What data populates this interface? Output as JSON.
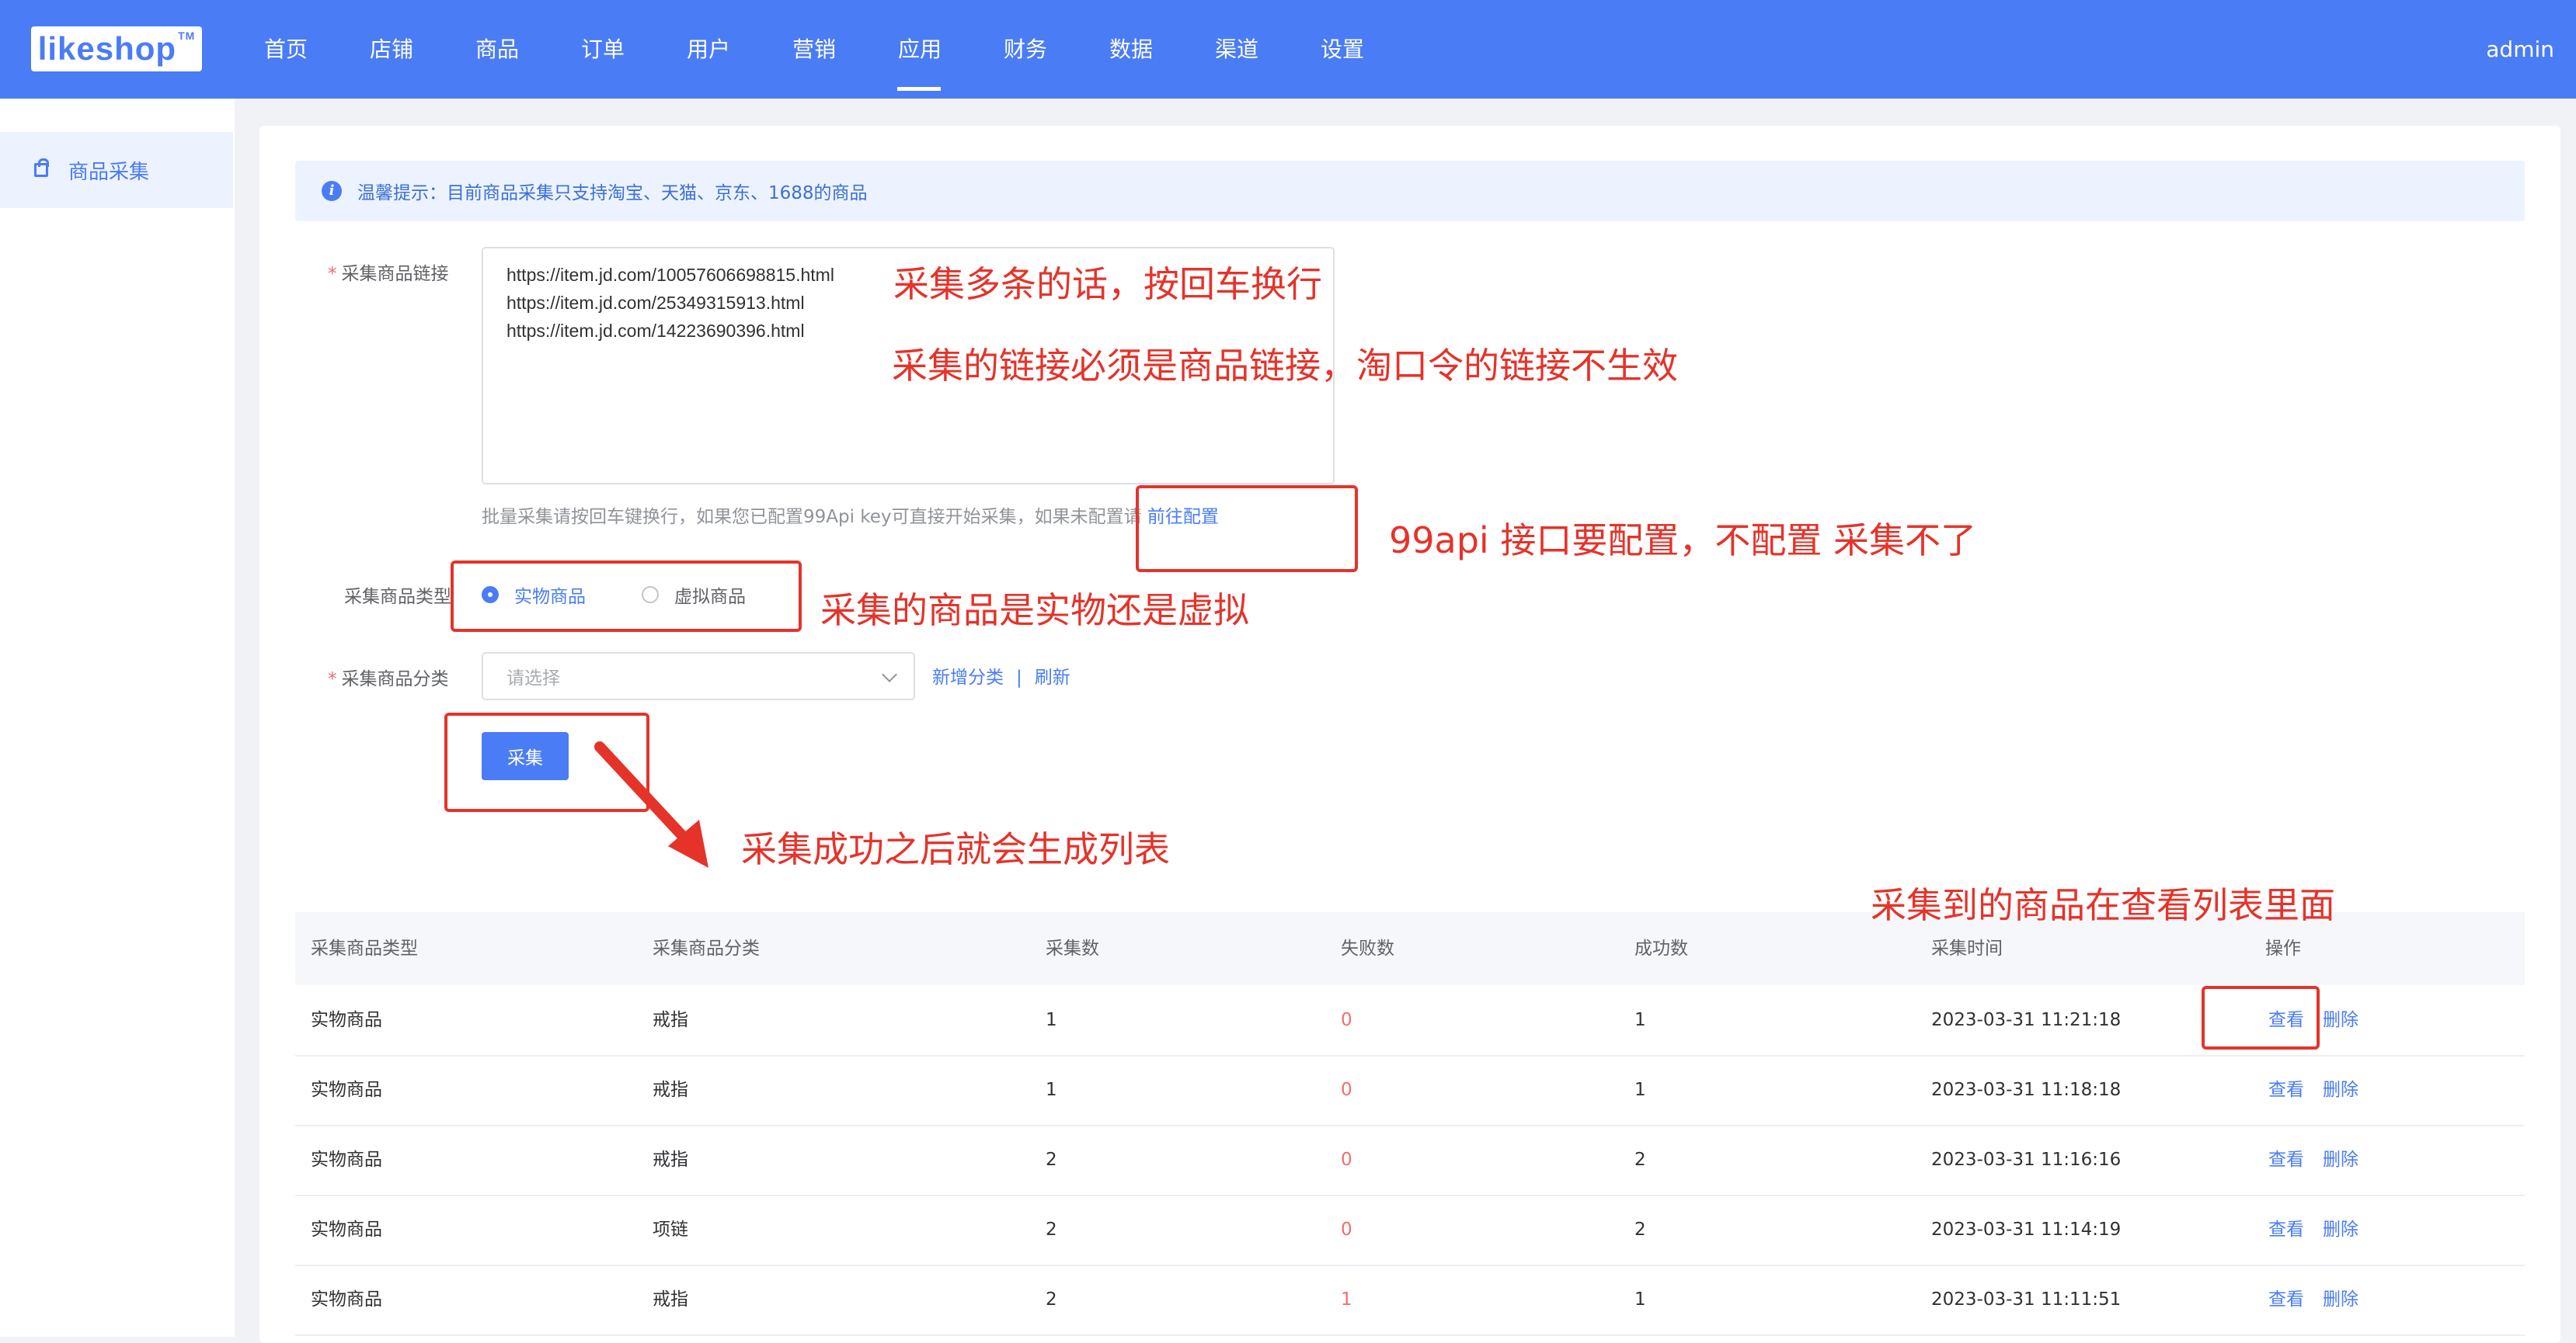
{
  "header": {
    "logo_text": "likeshop",
    "logo_tm": "TM",
    "nav": [
      "首页",
      "店铺",
      "商品",
      "订单",
      "用户",
      "营销",
      "应用",
      "财务",
      "数据",
      "渠道",
      "设置"
    ],
    "active_nav": "应用",
    "user": "admin"
  },
  "sidebar": {
    "items": [
      {
        "label": "商品采集",
        "icon": "bag-icon",
        "active": true
      }
    ]
  },
  "tip": {
    "text": "温馨提示：目前商品采集只支持淘宝、天猫、京东、1688的商品"
  },
  "form": {
    "link_label": "采集商品链接",
    "links_value": [
      "https://item.jd.com/10057606698815.html",
      "https://item.jd.com/25349315913.html",
      "https://item.jd.com/14223690396.html"
    ],
    "hint": "批量采集请按回车键换行，如果您已配置99Api key可直接开始采集，如果未配置请",
    "hint_link": "前往配置",
    "type_label": "采集商品类型",
    "type_options": [
      "实物商品",
      "虚拟商品"
    ],
    "type_selected": "实物商品",
    "category_label": "采集商品分类",
    "category_placeholder": "请选择",
    "add_category": "新增分类",
    "refresh": "刷新",
    "submit": "采集"
  },
  "table": {
    "columns": [
      "采集商品类型",
      "采集商品分类",
      "采集数",
      "失败数",
      "成功数",
      "采集时间",
      "操作"
    ],
    "rows": [
      {
        "type": "实物商品",
        "category": "戒指",
        "count": "1",
        "fail": "0",
        "success": "1",
        "time": "2023-03-31 11:21:18"
      },
      {
        "type": "实物商品",
        "category": "戒指",
        "count": "1",
        "fail": "0",
        "success": "1",
        "time": "2023-03-31 11:18:18"
      },
      {
        "type": "实物商品",
        "category": "戒指",
        "count": "2",
        "fail": "0",
        "success": "2",
        "time": "2023-03-31 11:16:16"
      },
      {
        "type": "实物商品",
        "category": "项链",
        "count": "2",
        "fail": "0",
        "success": "2",
        "time": "2023-03-31 11:14:19"
      },
      {
        "type": "实物商品",
        "category": "戒指",
        "count": "2",
        "fail": "1",
        "success": "1",
        "time": "2023-03-31 11:11:51"
      }
    ],
    "view": "查看",
    "delete": "删除"
  },
  "annotations": {
    "multi": "采集多条的话，按回车换行",
    "link_rule": "采集的链接必须是商品链接，淘口令的链接不生效",
    "api": "99api 接口要配置，不配置 采集不了",
    "type": "采集的商品是实物还是虚拟",
    "after": "采集成功之后就会生成列表",
    "view": "采集到的商品在查看列表里面"
  },
  "colors": {
    "brand": "#4a7cf6",
    "annotation": "#e5332a",
    "danger": "#f56c6c"
  }
}
